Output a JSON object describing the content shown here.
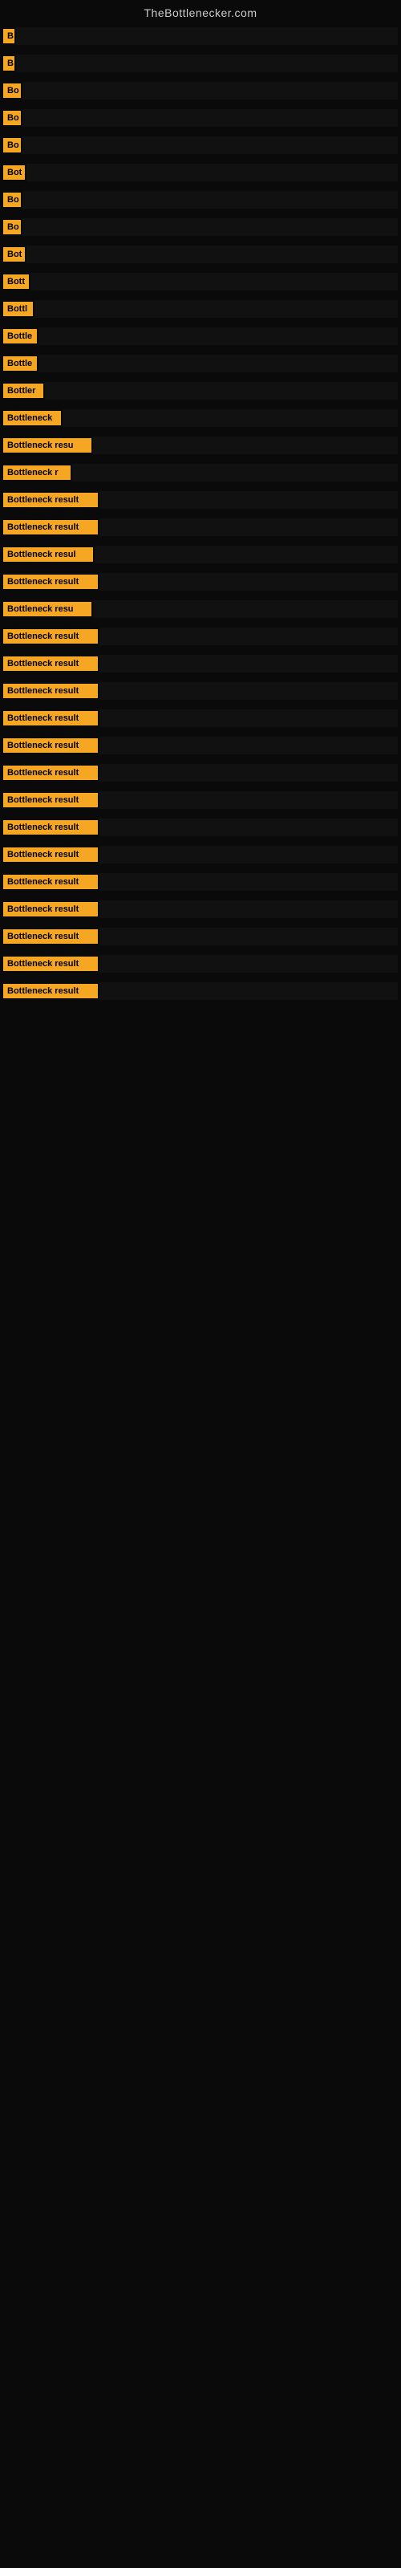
{
  "site": {
    "title": "TheBottlenecker.com"
  },
  "bars": [
    {
      "label": "B",
      "width": 14,
      "barWidth": 20
    },
    {
      "label": "B",
      "width": 14,
      "barWidth": 30
    },
    {
      "label": "Bo",
      "width": 22,
      "barWidth": 40
    },
    {
      "label": "Bo",
      "width": 22,
      "barWidth": 55
    },
    {
      "label": "Bo",
      "width": 22,
      "barWidth": 65
    },
    {
      "label": "Bot",
      "width": 27,
      "barWidth": 75
    },
    {
      "label": "Bo",
      "width": 22,
      "barWidth": 85
    },
    {
      "label": "Bo",
      "width": 22,
      "barWidth": 95
    },
    {
      "label": "Bot",
      "width": 27,
      "barWidth": 105
    },
    {
      "label": "Bott",
      "width": 32,
      "barWidth": 115
    },
    {
      "label": "Bottl",
      "width": 37,
      "barWidth": 125
    },
    {
      "label": "Bottle",
      "width": 42,
      "barWidth": 135
    },
    {
      "label": "Bottle",
      "width": 42,
      "barWidth": 145
    },
    {
      "label": "Bottler",
      "width": 50,
      "barWidth": 160
    },
    {
      "label": "Bottleneck",
      "width": 72,
      "barWidth": 180
    },
    {
      "label": "Bottleneck resu",
      "width": 110,
      "barWidth": 200
    },
    {
      "label": "Bottleneck r",
      "width": 84,
      "barWidth": 210
    },
    {
      "label": "Bottleneck result",
      "width": 118,
      "barWidth": 230
    },
    {
      "label": "Bottleneck result",
      "width": 118,
      "barWidth": 245
    },
    {
      "label": "Bottleneck resul",
      "width": 112,
      "barWidth": 255
    },
    {
      "label": "Bottleneck result",
      "width": 118,
      "barWidth": 265
    },
    {
      "label": "Bottleneck resu",
      "width": 110,
      "barWidth": 270
    },
    {
      "label": "Bottleneck result",
      "width": 118,
      "barWidth": 280
    },
    {
      "label": "Bottleneck result",
      "width": 118,
      "barWidth": 290
    },
    {
      "label": "Bottleneck result",
      "width": 118,
      "barWidth": 305
    },
    {
      "label": "Bottleneck result",
      "width": 118,
      "barWidth": 315
    },
    {
      "label": "Bottleneck result",
      "width": 118,
      "barWidth": 325
    },
    {
      "label": "Bottleneck result",
      "width": 118,
      "barWidth": 335
    },
    {
      "label": "Bottleneck result",
      "width": 118,
      "barWidth": 345
    },
    {
      "label": "Bottleneck result",
      "width": 118,
      "barWidth": 350
    },
    {
      "label": "Bottleneck result",
      "width": 118,
      "barWidth": 355
    },
    {
      "label": "Bottleneck result",
      "width": 118,
      "barWidth": 360
    },
    {
      "label": "Bottleneck result",
      "width": 118,
      "barWidth": 365
    },
    {
      "label": "Bottleneck result",
      "width": 118,
      "barWidth": 368
    },
    {
      "label": "Bottleneck result",
      "width": 118,
      "barWidth": 370
    },
    {
      "label": "Bottleneck result",
      "width": 118,
      "barWidth": 372
    }
  ]
}
